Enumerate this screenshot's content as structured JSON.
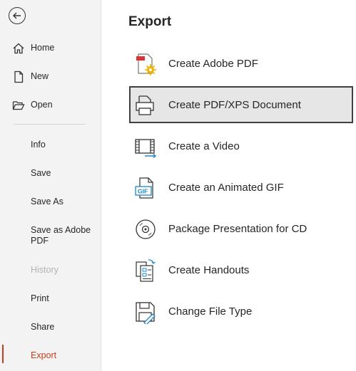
{
  "nav": {
    "home": "Home",
    "new": "New",
    "open": "Open",
    "info": "Info",
    "save": "Save",
    "save_as": "Save As",
    "save_as_adobe_pdf": "Save as Adobe PDF",
    "history": "History",
    "print": "Print",
    "share": "Share",
    "export": "Export"
  },
  "main": {
    "title": "Export",
    "options": {
      "adobe_pdf": "Create Adobe PDF",
      "pdf_xps": "Create PDF/XPS Document",
      "video": "Create a Video",
      "gif": "Create an Animated GIF",
      "package_cd": "Package Presentation for CD",
      "handouts": "Create Handouts",
      "change_type": "Change File Type"
    }
  },
  "colors": {
    "accent": "#c43e1c",
    "sidebar_bg": "#f3f3f3",
    "selected_bg": "#e6e6e6"
  },
  "icons": {
    "back": "back-arrow-icon",
    "home": "home-icon",
    "new": "new-document-icon",
    "open": "folder-open-icon",
    "adobe_pdf": "adobe-pdf-icon",
    "pdf_xps": "pdf-xps-document-icon",
    "video": "video-icon",
    "gif": "gif-icon",
    "package_cd": "cd-icon",
    "handouts": "handouts-icon",
    "change_type": "change-file-type-icon"
  }
}
